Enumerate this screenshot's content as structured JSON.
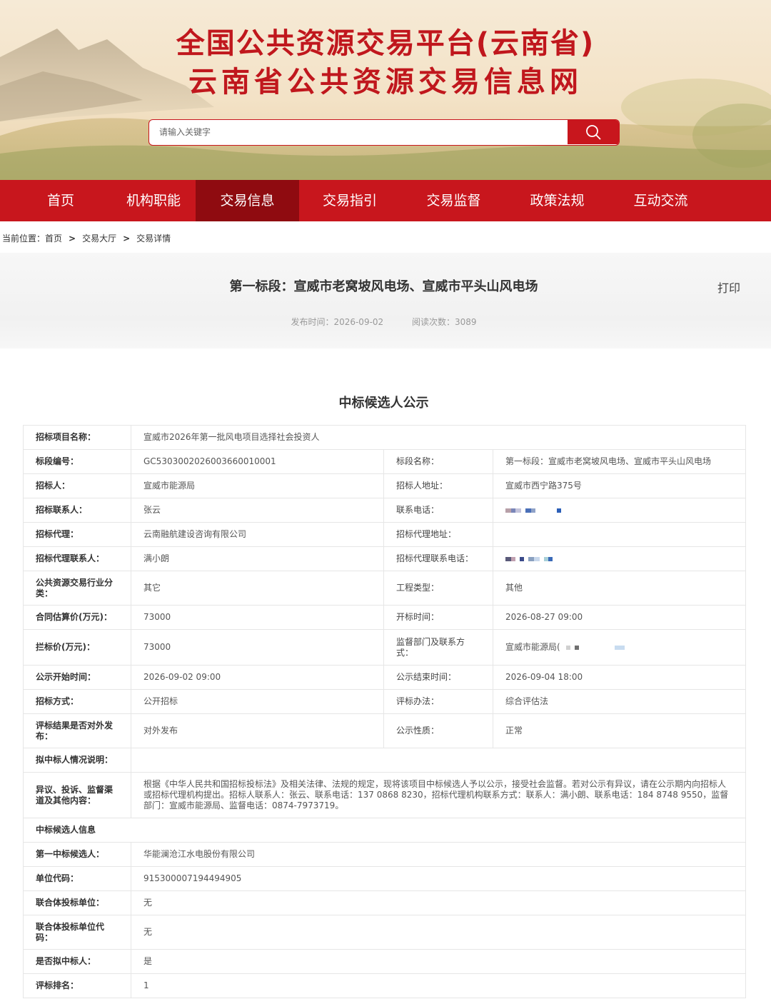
{
  "header": {
    "title_line1": "全国公共资源交易平台(云南省)",
    "title_line2": "云南省公共资源交易信息网",
    "search": {
      "placeholder": "请输入关键字"
    }
  },
  "nav": {
    "items": [
      "首页",
      "机构职能",
      "交易信息",
      "交易指引",
      "交易监督",
      "政策法规",
      "互动交流"
    ],
    "active_index": 2
  },
  "breadcrumb": {
    "label": "当前位置：",
    "items": [
      "首页",
      "交易大厅",
      "交易详情"
    ],
    "separator": ">"
  },
  "article": {
    "title": "第一标段：宣威市老窝坡风电场、宣威市平头山风电场",
    "print": "打印",
    "publish_time": "发布时间：2026-09-02",
    "read_count": "阅读次数：3089"
  },
  "notice": {
    "title": "中标候选人公示",
    "rows": {
      "project_name_label": "招标项目名称：",
      "project_name": "宣威市2026年第一批风电项目选择社会投资人",
      "tender_no_label": "标段编号：",
      "tender_no": "GC5303002026003660010001",
      "section_name_label": "标段名称：",
      "section_name": "第一标段：宣威市老窝坡风电场、宣威市平头山风电场",
      "tenderer_label": "招标人：",
      "tenderer": "宣威市能源局",
      "tenderer_addr_label": "招标人地址：",
      "tenderer_addr": "宣威市西宁路375号",
      "contact_label": "招标联系人：",
      "contact": "张云",
      "phone_label": "联系电话：",
      "agency_label": "招标代理：",
      "agency": "云南融航建设咨询有限公司",
      "agency_addr_label": "招标代理地址：",
      "agency_addr": "",
      "agency_contact_label": "招标代理联系人：",
      "agency_contact": "满小朗",
      "agency_phone_label": "招标代理联系电话：",
      "industry_label": "公共资源交易行业分类：",
      "industry": "其它",
      "project_type_label": "工程类型：",
      "project_type": "其他",
      "est_price_label": "合同估算价(万元)：",
      "est_price": "73000",
      "open_time_label": "开标时间：",
      "open_time": "2026-08-27 09:00",
      "ceiling_price_label": "拦标价(万元)：",
      "ceiling_price": "73000",
      "supervisor_label": "监督部门及联系方式：",
      "supervisor": "宣威市能源局(",
      "start_time_label": "公示开始时间：",
      "start_time": "2026-09-02 09:00",
      "end_time_label": "公示结束时间：",
      "end_time": "2026-09-04 18:00",
      "method_label": "招标方式：",
      "method": "公开招标",
      "eval_method_label": "评标办法：",
      "eval_method": "综合评估法",
      "publish_result_label": "评标结果是否对外发布：",
      "publish_result": "对外发布",
      "nature_label": "公示性质：",
      "nature": "正常",
      "winner_desc_label": "拟中标人情况说明：",
      "winner_desc": "",
      "objection_label": "异议、投诉、监督渠道及其他内容：",
      "objection": "根据《中华人民共和国招标投标法》及相关法律、法规的规定，现将该项目中标候选人予以公示，接受社会监督。若对公示有异议，请在公示期内向招标人或招标代理机构提出。招标人联系人：张云、联系电话：137 0868 8230，招标代理机构联系方式：联系人：满小朗、联系电话：184 8748 9550，监督部门：宣威市能源局、监督电话：0874-7973719。",
      "candidate_section": "中标候选人信息",
      "first_candidate_label": "第一中标候选人：",
      "first_candidate": "华能澜沧江水电股份有限公司",
      "unit_code_label": "单位代码：",
      "unit_code": "915300007194494905",
      "consortium_label": "联合体投标单位：",
      "consortium": "无",
      "consortium_code_label": "联合体投标单位代码：",
      "consortium_code": "无",
      "is_winner_label": "是否拟中标人：",
      "is_winner": "是",
      "rank_label": "评标排名：",
      "rank": "1"
    }
  },
  "colors": {
    "brand_red": "#c8161d",
    "nav_active": "#8f0b10",
    "title_red": "#c0171d"
  },
  "icons": {
    "search": "search-icon"
  }
}
